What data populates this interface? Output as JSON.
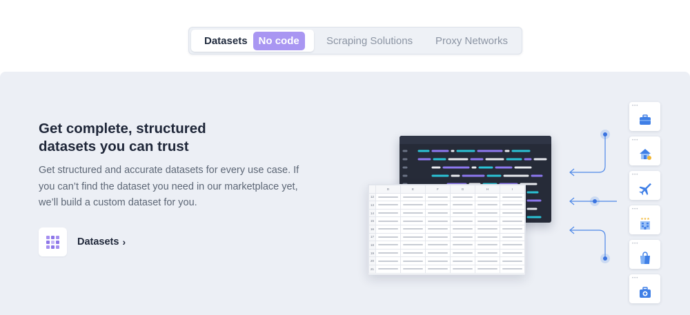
{
  "tabs": {
    "active_label": "Datasets",
    "active_badge": "No code",
    "items": [
      {
        "label": "Scraping Solutions"
      },
      {
        "label": "Proxy Networks"
      }
    ]
  },
  "hero": {
    "title_line1": "Get complete, structured",
    "title_line2": "datasets you can trust",
    "description_line1": "Get structured and accurate datasets for every use case. If",
    "description_line2": "you can’t find the dataset you need in our marketplace yet,",
    "description_line3": "we’ll build a custom dataset for you.",
    "link_label": "Datasets",
    "link_chevron": "›"
  },
  "illustration": {
    "sheet_columns": [
      "",
      "D",
      "E",
      "F",
      "G",
      "H",
      "I"
    ],
    "sheet_rows": [
      "12",
      "13",
      "14",
      "15",
      "16",
      "17",
      "18",
      "19",
      "20",
      "21"
    ],
    "category_icons": [
      "briefcase-icon",
      "home-icon",
      "airplane-icon",
      "hotel-icon",
      "shopping-bag-icon",
      "first-aid-icon"
    ],
    "colors": {
      "accent": "#a996f2",
      "arrow": "#4c87e8",
      "icon_blue": "#3f7fe6",
      "code_bg": "#262b38"
    }
  }
}
